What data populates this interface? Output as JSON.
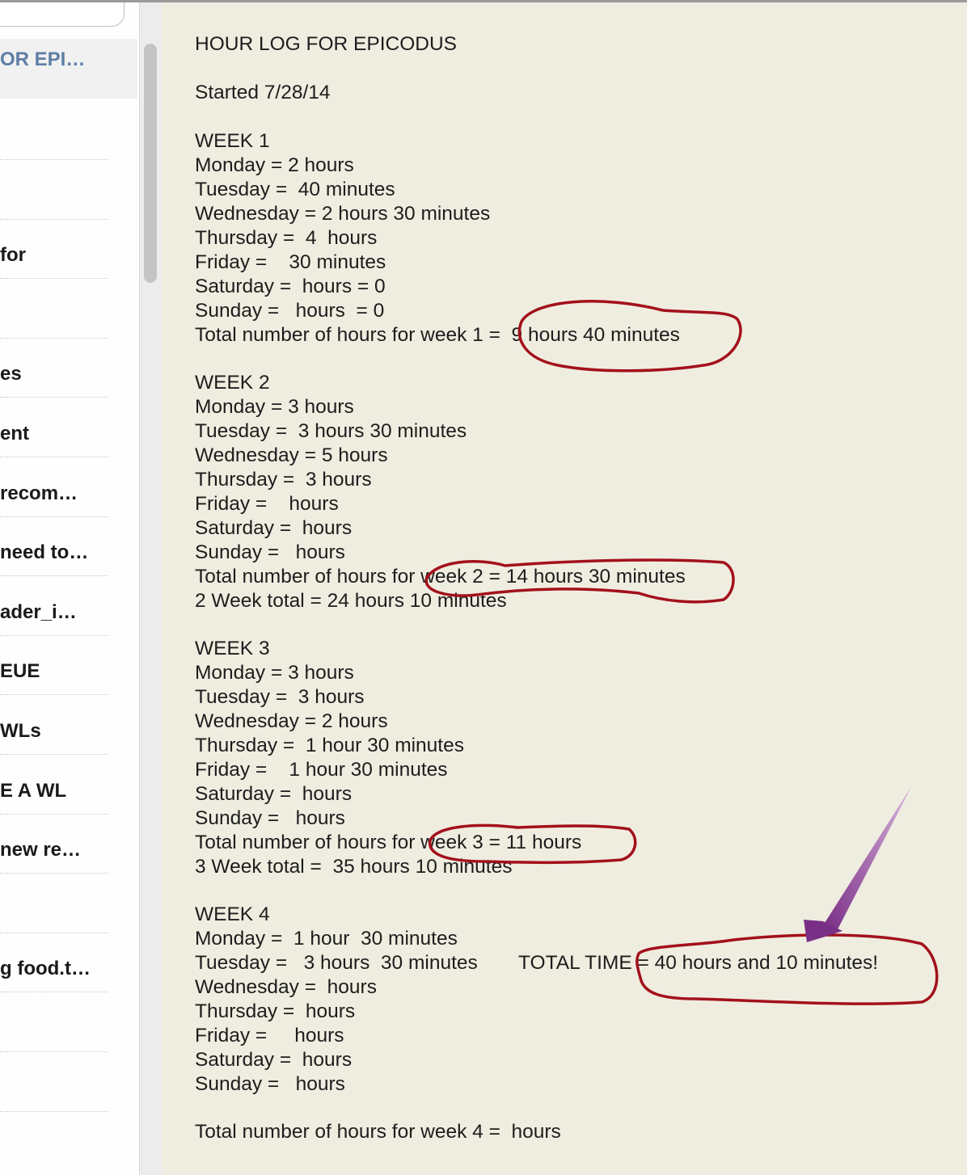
{
  "sidebar": {
    "notes": [
      {
        "title": "OR EPI…",
        "selected": true
      },
      {
        "title": ""
      },
      {
        "title": ""
      },
      {
        "title": "for"
      },
      {
        "title": ""
      },
      {
        "title": "es"
      },
      {
        "title": "ent"
      },
      {
        "title": "recom…"
      },
      {
        "title": "need to…"
      },
      {
        "title": "ader_i…"
      },
      {
        "title": "EUE"
      },
      {
        "title": "WLs"
      },
      {
        "title": "E A WL"
      },
      {
        "title": "new re…"
      },
      {
        "title": ""
      },
      {
        "title": "g food.t…"
      },
      {
        "title": ""
      },
      {
        "title": ""
      }
    ]
  },
  "note": {
    "title": "HOUR LOG FOR EPICODUS",
    "started": "Started 7/28/14",
    "week1": {
      "heading": "WEEK 1",
      "lines": [
        "Monday = 2 hours",
        "Tuesday =  40 minutes",
        "Wednesday = 2 hours 30 minutes",
        "Thursday =  4  hours",
        "Friday =    30 minutes",
        "Saturday =  hours = 0",
        "Sunday =   hours  = 0",
        "Total number of hours for week 1 =  9 hours 40 minutes"
      ]
    },
    "week2": {
      "heading": "WEEK 2",
      "lines": [
        "Monday = 3 hours",
        "Tuesday =  3 hours 30 minutes",
        "Wednesday = 5 hours",
        "Thursday =  3 hours",
        "Friday =    hours",
        "Saturday =  hours",
        "Sunday =   hours",
        "Total number of hours for week 2 = 14 hours 30 minutes",
        "2 Week total = 24 hours 10 minutes"
      ]
    },
    "week3": {
      "heading": "WEEK 3",
      "lines": [
        "Monday = 3 hours",
        "Tuesday =  3 hours",
        "Wednesday = 2 hours",
        "Thursday =  1 hour 30 minutes",
        "Friday =    1 hour 30 minutes",
        "Saturday =  hours",
        "Sunday =   hours",
        "Total number of hours for week 3 = 11 hours",
        "3 Week total =  35 hours 10 minutes"
      ]
    },
    "week4": {
      "heading": "WEEK 4",
      "lines": [
        "Monday =  1 hour  30 minutes",
        "Tuesday =   3 hours  30 minutes",
        "Wednesday =  hours",
        "Thursday =  hours",
        "Friday =     hours",
        "Saturday =  hours",
        "Sunday =   hours"
      ],
      "total": "Total number of hours for week 4 =  hours"
    },
    "total_time": "TOTAL TIME = 40 hours and 10 minutes!"
  },
  "colors": {
    "annotation_ink": "#a3101c",
    "arrow_purple": "#8a3f95",
    "note_background": "#efede0",
    "sidebar_selected_text": "#5f7ea6"
  },
  "icons": {
    "arrow": "purple-arrow-icon"
  }
}
